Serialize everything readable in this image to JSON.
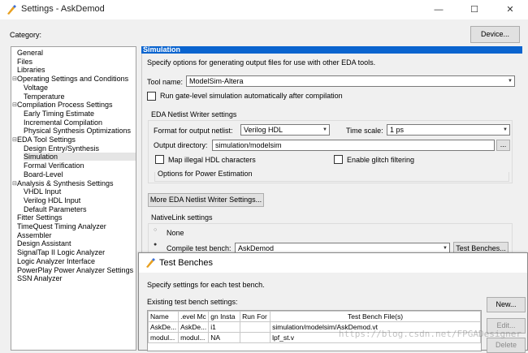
{
  "window": {
    "title": "Settings - AskDemod",
    "minimize": "—",
    "maximize": "☐",
    "close": "✕"
  },
  "category_label": "Category:",
  "device_button": "Device...",
  "tree": [
    {
      "label": "General",
      "indent": 0
    },
    {
      "label": "Files",
      "indent": 0
    },
    {
      "label": "Libraries",
      "indent": 0
    },
    {
      "label": "Operating Settings and Conditions",
      "indent": 0,
      "twisty": "minus"
    },
    {
      "label": "Voltage",
      "indent": 1
    },
    {
      "label": "Temperature",
      "indent": 1
    },
    {
      "label": "Compilation Process Settings",
      "indent": 0,
      "twisty": "minus"
    },
    {
      "label": "Early Timing Estimate",
      "indent": 1
    },
    {
      "label": "Incremental Compilation",
      "indent": 1
    },
    {
      "label": "Physical Synthesis Optimizations",
      "indent": 1
    },
    {
      "label": "EDA Tool Settings",
      "indent": 0,
      "twisty": "minus"
    },
    {
      "label": "Design Entry/Synthesis",
      "indent": 1
    },
    {
      "label": "Simulation",
      "indent": 1,
      "selected": true
    },
    {
      "label": "Formal Verification",
      "indent": 1
    },
    {
      "label": "Board-Level",
      "indent": 1
    },
    {
      "label": "Analysis & Synthesis Settings",
      "indent": 0,
      "twisty": "minus"
    },
    {
      "label": "VHDL Input",
      "indent": 1
    },
    {
      "label": "Verilog HDL Input",
      "indent": 1
    },
    {
      "label": "Default Parameters",
      "indent": 1
    },
    {
      "label": "Fitter Settings",
      "indent": 0
    },
    {
      "label": "TimeQuest Timing Analyzer",
      "indent": 0
    },
    {
      "label": "Assembler",
      "indent": 0
    },
    {
      "label": "Design Assistant",
      "indent": 0
    },
    {
      "label": "SignalTap II Logic Analyzer",
      "indent": 0
    },
    {
      "label": "Logic Analyzer Interface",
      "indent": 0
    },
    {
      "label": "PowerPlay Power Analyzer Settings",
      "indent": 0
    },
    {
      "label": "SSN Analyzer",
      "indent": 0
    }
  ],
  "simulation": {
    "header": "Simulation",
    "description": "Specify options for generating output files for use with other EDA tools.",
    "tool_name_label": "Tool name:",
    "tool_name_value": "ModelSim-Altera",
    "run_gate_level": "Run gate-level simulation automatically after compilation",
    "netlist_group": "EDA Netlist Writer settings",
    "format_label": "Format for output netlist:",
    "format_value": "Verilog HDL",
    "time_scale_label": "Time scale:",
    "time_scale_value": "1 ps",
    "output_dir_label": "Output directory:",
    "output_dir_value": "simulation/modelsim",
    "browse_button": "...",
    "map_illegal": "Map illegal HDL characters",
    "enable_glitch": "Enable glitch filtering",
    "power_group": "Options for Power Estimation",
    "more_button": "More EDA Netlist Writer Settings...",
    "nativelink_group": "NativeLink settings",
    "none_label": "None",
    "compile_tb_label": "Compile test bench:",
    "compile_tb_value": "AskDemod",
    "test_benches_button": "Test Benches..."
  },
  "dialog": {
    "title": "Test Benches",
    "description": "Specify settings for each test bench.",
    "existing_label": "Existing test bench settings:",
    "columns": [
      "Name",
      ".evel Mc",
      "gn Insta",
      "Run For",
      "Test Bench File(s)"
    ],
    "rows": [
      [
        "AskDe...",
        "AskDe...",
        "i1",
        "",
        "simulation/modelsim/AskDemod.vt"
      ],
      [
        "modul...",
        "modul...",
        "NA",
        "",
        "lpf_st.v"
      ]
    ],
    "new_button": "New...",
    "edit_button": "Edit...",
    "delete_button": "Delete"
  },
  "watermark": "https://blog.csdn.net/FPGADesigner"
}
